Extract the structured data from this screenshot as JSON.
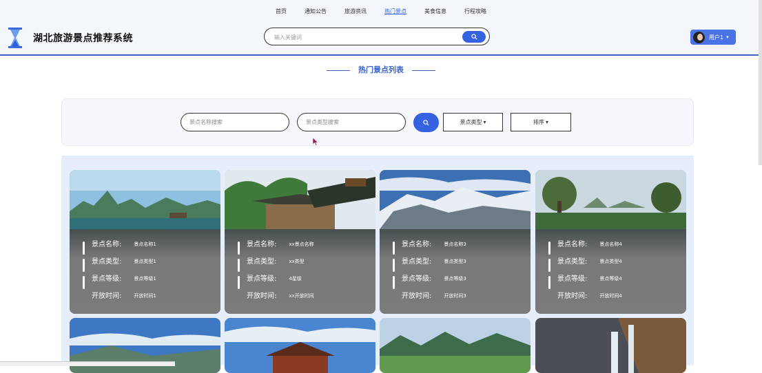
{
  "header": {
    "nav": [
      "首页",
      "通知公告",
      "旅游资讯",
      "热门景点",
      "美食信息",
      "行程攻略"
    ],
    "active_nav": "热门景点",
    "site_title": "湖北旅游景点推荐系统",
    "search_placeholder": "输入关键词",
    "user_name": "用户1"
  },
  "section_title": "热门景点列表",
  "filters": {
    "name_placeholder": "景点名称搜索",
    "type_placeholder": "景点类型搜索",
    "type_dropdown": "景点类型",
    "sort_dropdown": "排序"
  },
  "field_labels": {
    "name": "景点名称:",
    "type": "景点类型:",
    "level": "景点等级:",
    "open": "开放时间:"
  },
  "cards": [
    {
      "name": "景点名称1",
      "type": "景点类型1",
      "level": "景点等级1",
      "open": "开放时间1"
    },
    {
      "name": "xx景点名称",
      "type": "xx类型",
      "level": "4星级",
      "open": "xx开放时间"
    },
    {
      "name": "景点名称3",
      "type": "景点类型3",
      "level": "景点等级3",
      "open": "开放时间3"
    },
    {
      "name": "景点名称4",
      "type": "景点类型4",
      "level": "景点等级4",
      "open": "开放时间4"
    }
  ],
  "colors": {
    "accent": "#3562e0",
    "header_line": "#3b63c9",
    "title_blue": "#3b63c9"
  }
}
